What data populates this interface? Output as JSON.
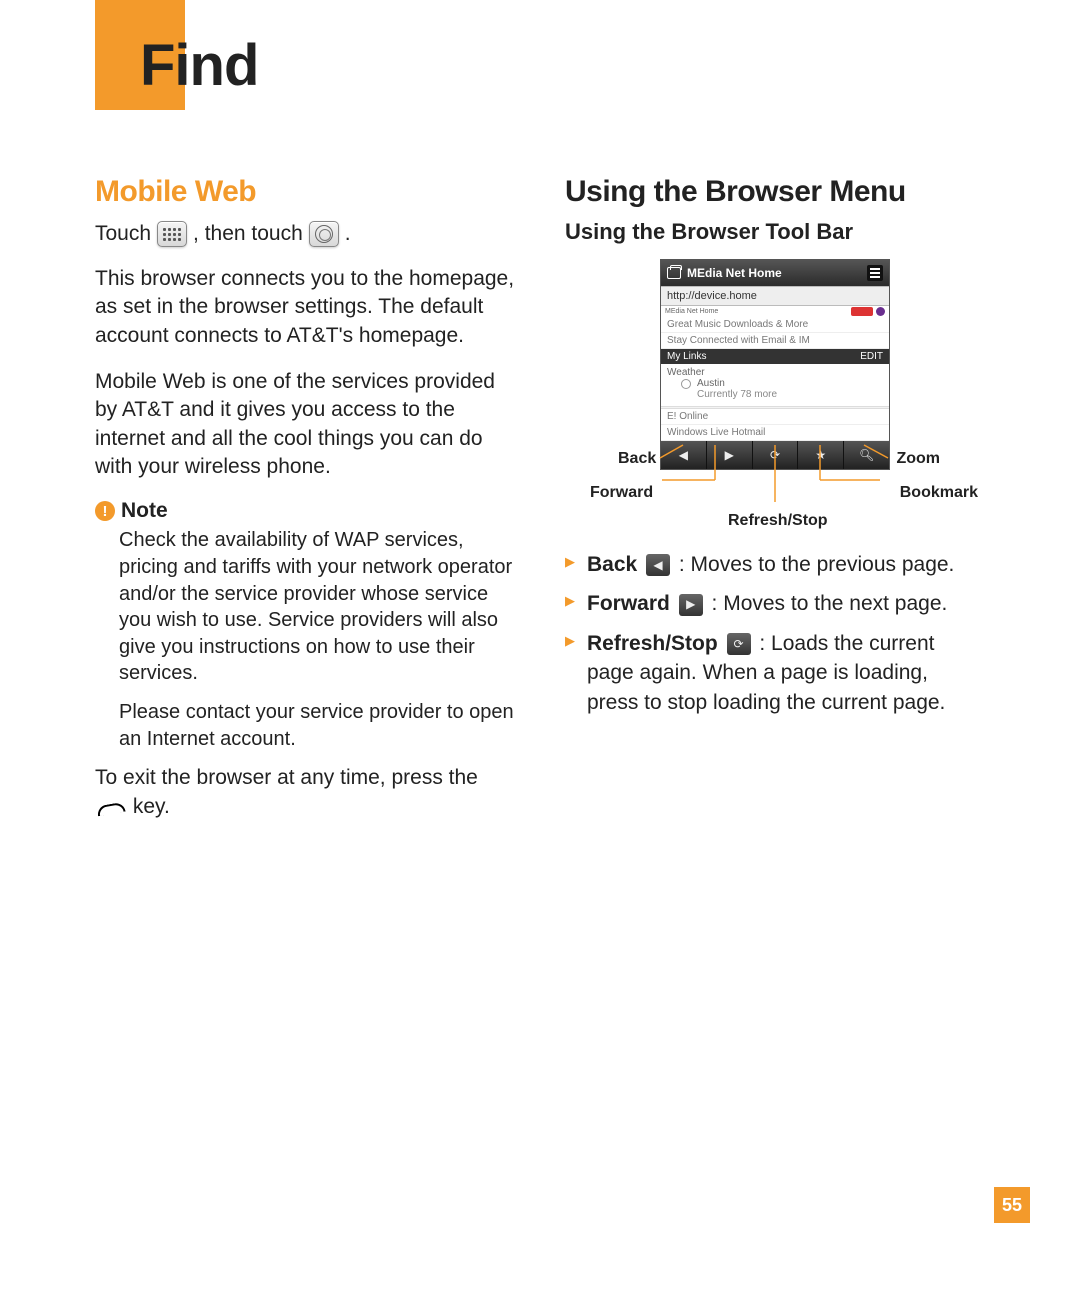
{
  "page_title": "Find",
  "page_number": "55",
  "left": {
    "h2": "Mobile Web",
    "touch_pre": "Touch",
    "touch_mid": ", then touch",
    "touch_post": ".",
    "p1": "This browser connects you to the homepage, as set in the browser settings. The default account connects to AT&T's homepage.",
    "p2": "Mobile Web is one of the services provided by AT&T and it gives you access to the internet and all the cool things you can do with your wireless phone.",
    "note_title": "Note",
    "note_p1": "Check the availability of WAP services, pricing and tariffs with your network operator and/or the service provider whose service you wish to use. Service providers will also give you instructions on how to use their services.",
    "note_p2": "Please contact your service provider to open an Internet account.",
    "exit_pre": "To exit the browser at any time, press the",
    "exit_post": "key."
  },
  "right": {
    "h2": "Using the Browser Menu",
    "h3": "Using the Browser Tool Bar",
    "callout_back": "Back",
    "callout_forward": "Forward",
    "callout_refresh": "Refresh/Stop",
    "callout_zoom": "Zoom",
    "callout_bookmark": "Bookmark",
    "defs": {
      "back_label": "Back",
      "back_text": ": Moves to the previous page.",
      "fwd_label": "Forward",
      "fwd_text": ": Moves to the next page.",
      "ref_label": "Refresh/Stop",
      "ref_text": ": Loads the current page again. When a page is loading, press to stop loading the current page."
    },
    "phone": {
      "title": "MEdia Net Home",
      "url": "http://device.home",
      "thin_left": "MEdia Net Home",
      "line1": "Great Music Downloads & More",
      "line2": "Stay Connected with Email & IM",
      "band_left": "My Links",
      "band_right": "EDIT",
      "weather_label": "Weather",
      "city": "Austin",
      "currently": "Currently 78 more",
      "list1": "E! Online",
      "list2": "Windows Live Hotmail"
    }
  }
}
